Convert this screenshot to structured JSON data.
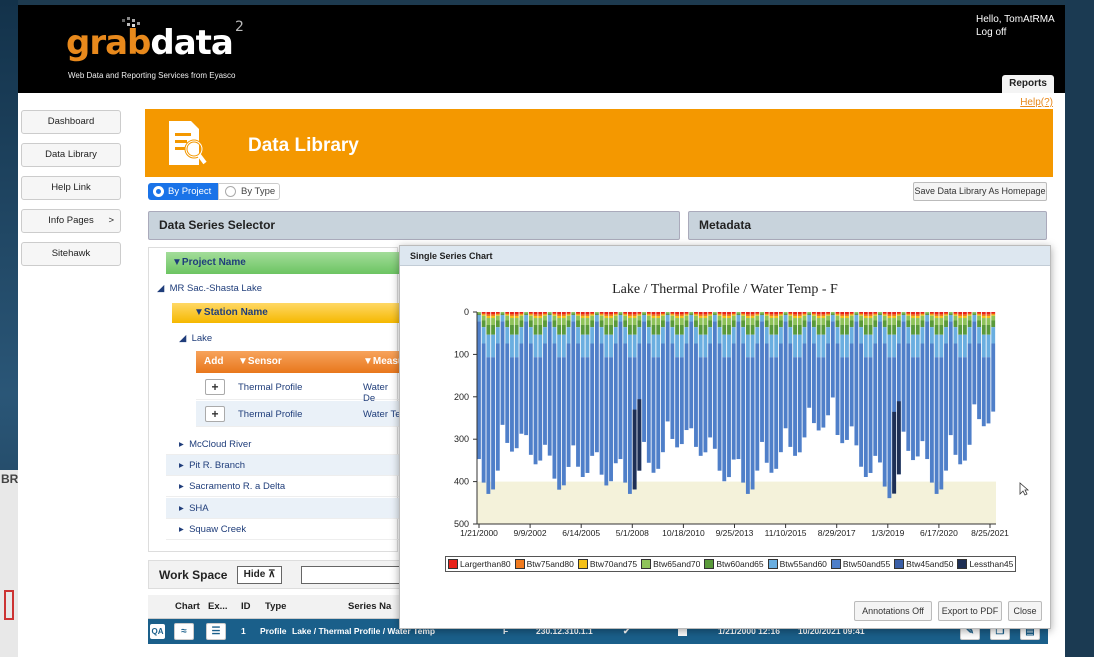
{
  "header": {
    "logo_grab": "grab",
    "logo_data": "data",
    "logo_sup": "2",
    "tagline": "Web Data and Reporting Services from Eyasco",
    "greeting": "Hello, TomAtRMA",
    "logoff": "Log off",
    "reports_tab": "Reports",
    "help_link": "Help(?)"
  },
  "side_peek_label": "BR",
  "sidebar": {
    "items": [
      {
        "label": "Dashboard"
      },
      {
        "label": "Data Library"
      },
      {
        "label": "Help Link"
      },
      {
        "label": "Info Pages",
        "arrow": ">"
      },
      {
        "label": "Sitehawk"
      }
    ]
  },
  "banner": {
    "title": "Data Library"
  },
  "view_toggle": {
    "by_project": "By Project",
    "by_type": "By Type",
    "selected": "By Project"
  },
  "save_homepage_label": "Save Data Library As Homepage",
  "panels": {
    "selector_title": "Data Series Selector",
    "metadata_title": "Metadata"
  },
  "selector": {
    "project_header": "Project Name",
    "project": "MR Sac.-Shasta Lake",
    "station_header": "Station Name",
    "station_open": "Lake",
    "sensor_cols": [
      "Add",
      "Sensor",
      "Measu"
    ],
    "sensors": [
      {
        "add": "+",
        "sensor": "Thermal Profile",
        "measure": "Water De"
      },
      {
        "add": "+",
        "sensor": "Thermal Profile",
        "measure": "Water Te"
      }
    ],
    "other_stations": [
      "McCloud River",
      "Pit R. Branch",
      "Sacramento R. a Delta",
      "SHA",
      "Squaw Creek"
    ]
  },
  "workspace": {
    "title": "Work Space",
    "hide_label": "Hide",
    "columns": [
      "Chart",
      "Ex...",
      "ID",
      "Type",
      "Series Na"
    ],
    "row": {
      "qa": "QA",
      "id": "1",
      "type": "Profile",
      "series": "Lake / Thermal Profile / Water Temp",
      "unit": "F",
      "code": "230.12.310.1.1",
      "start": "1/21/2000 12:16",
      "end": "10/20/2021 09:41"
    }
  },
  "dialog": {
    "title": "Single Series Chart",
    "buttons": [
      "Annotations Off",
      "Export to PDF",
      "Close"
    ]
  },
  "chart_data": {
    "type": "heatmap",
    "title": "Lake / Thermal Profile / Water Temp - F",
    "xlabel": "",
    "ylabel": "",
    "y_ticks": [
      0,
      100,
      200,
      300,
      400,
      500
    ],
    "ylim": [
      0,
      500
    ],
    "y_inverted": true,
    "x_ticks": [
      "1/21/2000",
      "9/9/2002",
      "6/14/2005",
      "5/1/2008",
      "10/18/2010",
      "9/25/2013",
      "11/10/2015",
      "8/29/2017",
      "1/3/2019",
      "6/17/2020",
      "8/25/2021"
    ],
    "background_bands": [
      {
        "from": 300,
        "to": 400,
        "color": "#ffffff"
      },
      {
        "from": 400,
        "to": 500,
        "color": "#f4f2da"
      }
    ],
    "legend": [
      {
        "name": "Largerthan80",
        "color": "#e8231b"
      },
      {
        "name": "Btw75and80",
        "color": "#f07a1e"
      },
      {
        "name": "Btw70and75",
        "color": "#f5c016"
      },
      {
        "name": "Btw65and70",
        "color": "#8fc35a"
      },
      {
        "name": "Btw60and65",
        "color": "#5a9a3a"
      },
      {
        "name": "Btw55and60",
        "color": "#6aaee0"
      },
      {
        "name": "Btw50and55",
        "color": "#4f7fc9"
      },
      {
        "name": "Btw45and50",
        "color": "#3a5fa8"
      },
      {
        "name": "Lessthan45",
        "color": "#1e2f55"
      }
    ],
    "profile_max_depth_by_year": [
      {
        "year": 2000,
        "depth": 430
      },
      {
        "year": 2001,
        "depth": 330
      },
      {
        "year": 2002,
        "depth": 360
      },
      {
        "year": 2003,
        "depth": 420
      },
      {
        "year": 2004,
        "depth": 390
      },
      {
        "year": 2005,
        "depth": 410
      },
      {
        "year": 2006,
        "depth": 430
      },
      {
        "year": 2007,
        "depth": 380
      },
      {
        "year": 2008,
        "depth": 320
      },
      {
        "year": 2009,
        "depth": 340
      },
      {
        "year": 2010,
        "depth": 400
      },
      {
        "year": 2011,
        "depth": 430
      },
      {
        "year": 2012,
        "depth": 380
      },
      {
        "year": 2013,
        "depth": 340
      },
      {
        "year": 2014,
        "depth": 280
      },
      {
        "year": 2015,
        "depth": 310
      },
      {
        "year": 2016,
        "depth": 390
      },
      {
        "year": 2017,
        "depth": 440
      },
      {
        "year": 2018,
        "depth": 350
      },
      {
        "year": 2019,
        "depth": 430
      },
      {
        "year": 2020,
        "depth": 360
      },
      {
        "year": 2021,
        "depth": 270
      }
    ]
  }
}
